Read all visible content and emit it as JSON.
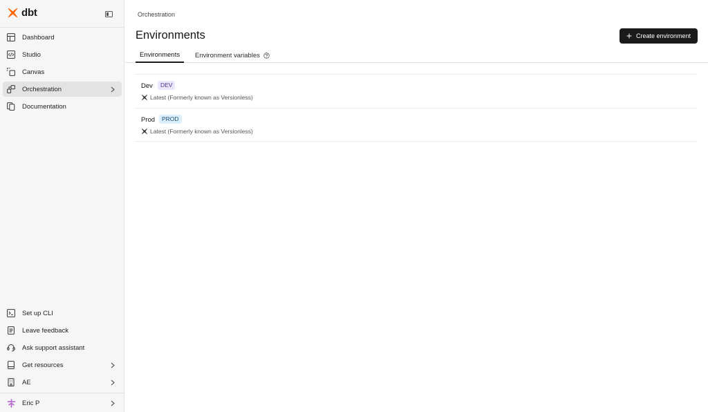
{
  "app": {
    "logo_text": "dbt",
    "brand_color": "#fe6703"
  },
  "sidebar": {
    "top_items": [
      {
        "label": "Dashboard",
        "icon": "dashboard-icon"
      },
      {
        "label": "Studio",
        "icon": "code-icon"
      },
      {
        "label": "Canvas",
        "icon": "canvas-icon"
      },
      {
        "label": "Orchestration",
        "icon": "orchestration-icon",
        "active": true
      },
      {
        "label": "Documentation",
        "icon": "documentation-icon"
      }
    ],
    "bottom_items": [
      {
        "label": "Set up CLI",
        "icon": "terminal-icon"
      },
      {
        "label": "Leave feedback",
        "icon": "feedback-icon"
      },
      {
        "label": "Ask support assistant",
        "icon": "headset-icon"
      },
      {
        "label": "Get resources",
        "icon": "book-icon"
      },
      {
        "label": "AE",
        "icon": "building-icon"
      }
    ],
    "user": {
      "name": "Eric P",
      "icon": "user-avatar-icon"
    }
  },
  "main": {
    "breadcrumb": "Orchestration",
    "title": "Environments",
    "create_button_label": "Create environment",
    "tabs": [
      {
        "label": "Environments",
        "active": true
      },
      {
        "label": "Environment variables",
        "help_icon": "help-circle-icon"
      }
    ],
    "environments": [
      {
        "name": "Dev",
        "badge": "DEV",
        "version": "Latest (Formerly known as Versionless)"
      },
      {
        "name": "Prod",
        "badge": "PROD",
        "version": "Latest (Formerly known as Versionless)"
      }
    ]
  }
}
